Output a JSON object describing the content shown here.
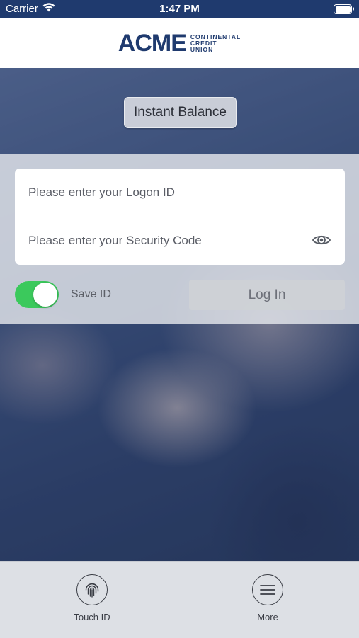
{
  "status_bar": {
    "carrier": "Carrier",
    "time": "1:47 PM"
  },
  "header": {
    "logo_main": "ACME",
    "logo_sub": [
      "CONTINENTAL",
      "CREDIT",
      "UNION"
    ]
  },
  "instant_balance": {
    "label": "Instant Balance"
  },
  "login": {
    "logon_placeholder": "Please enter your Logon ID",
    "security_placeholder": "Please enter your Security Code",
    "save_id_label": "Save ID",
    "save_id_enabled": true,
    "login_button": "Log In"
  },
  "bottom_bar": {
    "touch_id_label": "Touch ID",
    "more_label": "More"
  },
  "colors": {
    "brand": "#1f3a6e",
    "toggle_on": "#3bc95c"
  },
  "icons": [
    "wifi-icon",
    "battery-icon",
    "eye-icon",
    "fingerprint-icon",
    "menu-icon"
  ]
}
